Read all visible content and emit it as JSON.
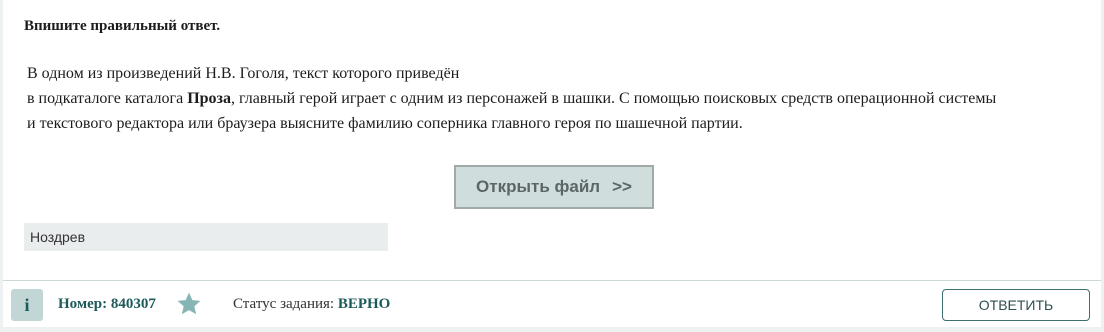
{
  "task": {
    "prompt": "Впишите правильный ответ.",
    "line1": "В одном из произведений Н.В. Гоголя, текст которого приведён",
    "line2_before": "в подкаталоге каталога ",
    "line2_bold": "Проза",
    "line2_after": ", главный герой играет с одним из персонажей в шашки. С помощью поисковых средств операционной системы",
    "line3": "и текстового редактора или браузера выясните фамилию соперника главного героя по шашечной партии."
  },
  "open_file": {
    "label": "Открыть файл",
    "arrows": ">>"
  },
  "answer": {
    "value": "Ноздрев"
  },
  "footer": {
    "info_icon_glyph": "i",
    "number_label": "Номер: 840307",
    "star_icon": "star-icon",
    "status_label": "Статус задания: ",
    "status_value": "ВЕРНО",
    "reply_label": "ОТВЕТИТЬ"
  },
  "colors": {
    "accent": "#1c5a5a",
    "star": "#86b5b5",
    "button_bg": "#cfdddd"
  }
}
